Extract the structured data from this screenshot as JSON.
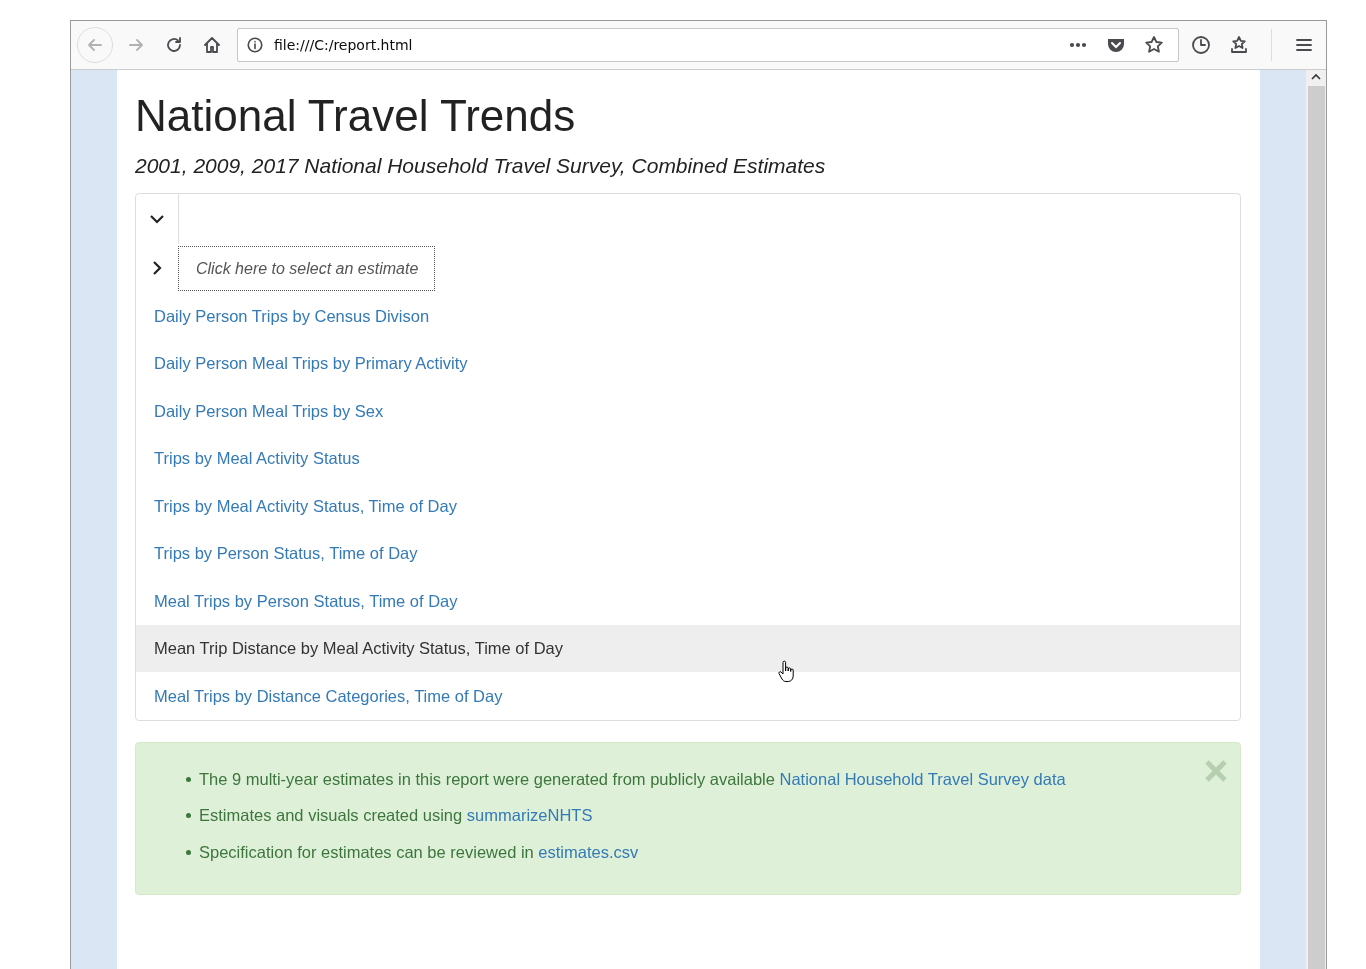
{
  "browser": {
    "url": "file:///C:/report.html"
  },
  "page": {
    "title": "National Travel Trends",
    "subtitle": "2001, 2009, 2017 National Household Travel Survey, Combined Estimates"
  },
  "selector": {
    "expanded": true,
    "prompt": "Click here to select an estimate",
    "items": [
      {
        "label": "Daily Person Trips by Census Divison",
        "highlighted": false
      },
      {
        "label": "Daily Person Meal Trips by Primary Activity",
        "highlighted": false
      },
      {
        "label": "Daily Person Meal Trips by Sex",
        "highlighted": false
      },
      {
        "label": "Trips by Meal Activity Status",
        "highlighted": false
      },
      {
        "label": "Trips by Meal Activity Status, Time of Day",
        "highlighted": false
      },
      {
        "label": "Trips by Person Status, Time of Day",
        "highlighted": false
      },
      {
        "label": "Meal Trips by Person Status, Time of Day",
        "highlighted": false
      },
      {
        "label": "Mean Trip Distance by Meal Activity Status, Time of Day",
        "highlighted": true
      },
      {
        "label": "Meal Trips by Distance Categories, Time of Day",
        "highlighted": false
      }
    ]
  },
  "notice": {
    "items": [
      {
        "text": "The 9 multi-year estimates in this report were generated from publicly available",
        "link": "National Household Travel Survey data"
      },
      {
        "text": "Estimates and visuals created using",
        "link": "summarizeNHTS"
      },
      {
        "text": "Specification for estimates can be reviewed in",
        "link": "estimates.csv"
      }
    ]
  }
}
